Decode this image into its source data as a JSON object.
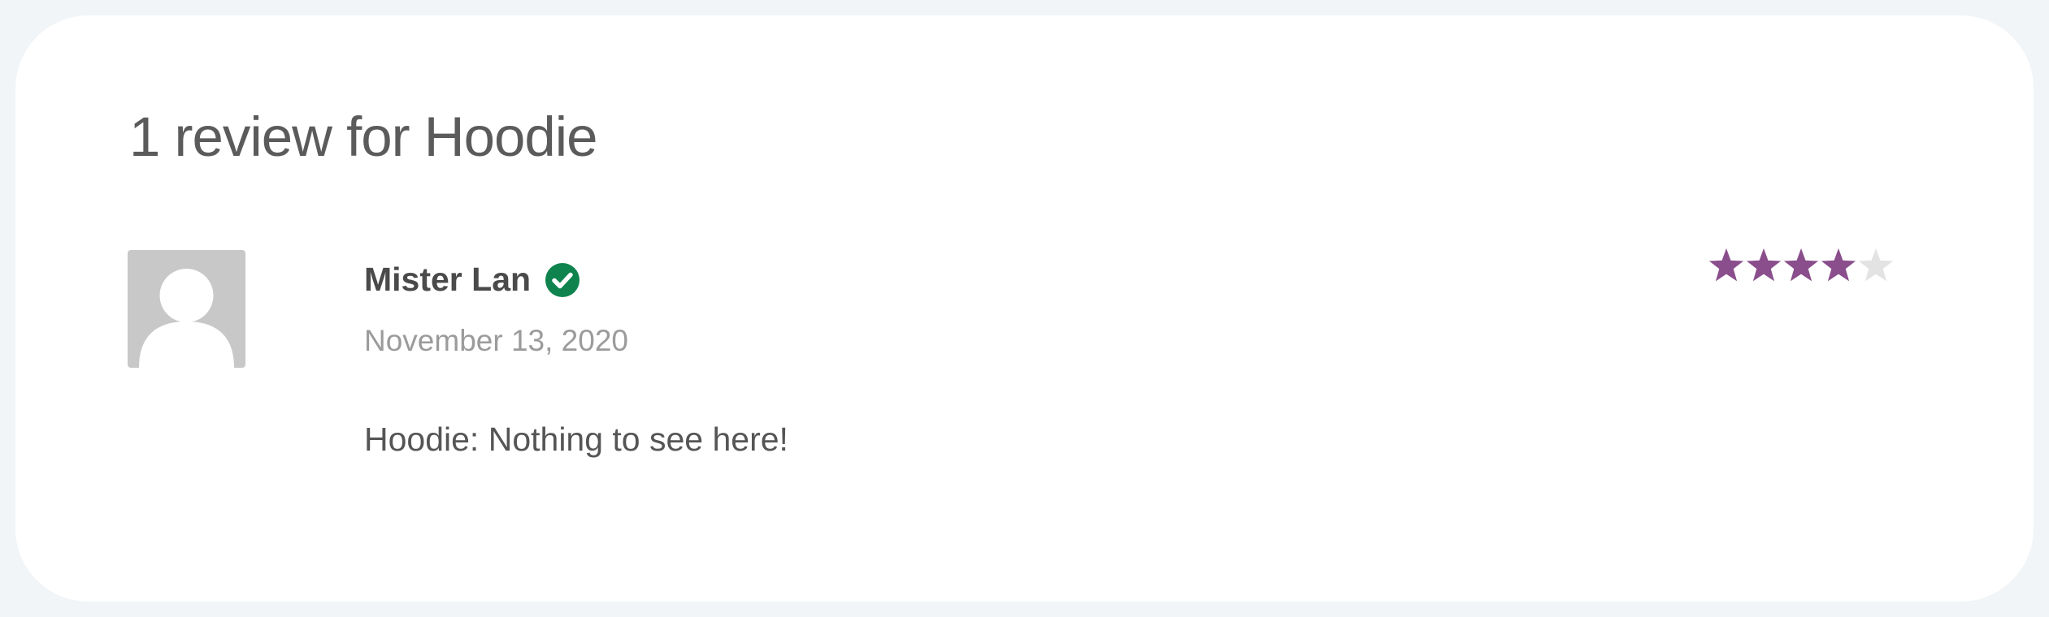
{
  "review_section": {
    "heading": "1 review for Hoodie"
  },
  "review": {
    "author": "Mister Lan",
    "verified_icon": "verified-owner-check-icon",
    "date": "November 13, 2020",
    "text": "Hoodie: Nothing to see here!",
    "rating": 4,
    "rating_max": 5
  },
  "colors": {
    "star_filled": "#8a4e8c",
    "star_empty": "#e3e3e3",
    "verified_badge": "#0f834d",
    "avatar_bg": "#c8c8c8"
  }
}
